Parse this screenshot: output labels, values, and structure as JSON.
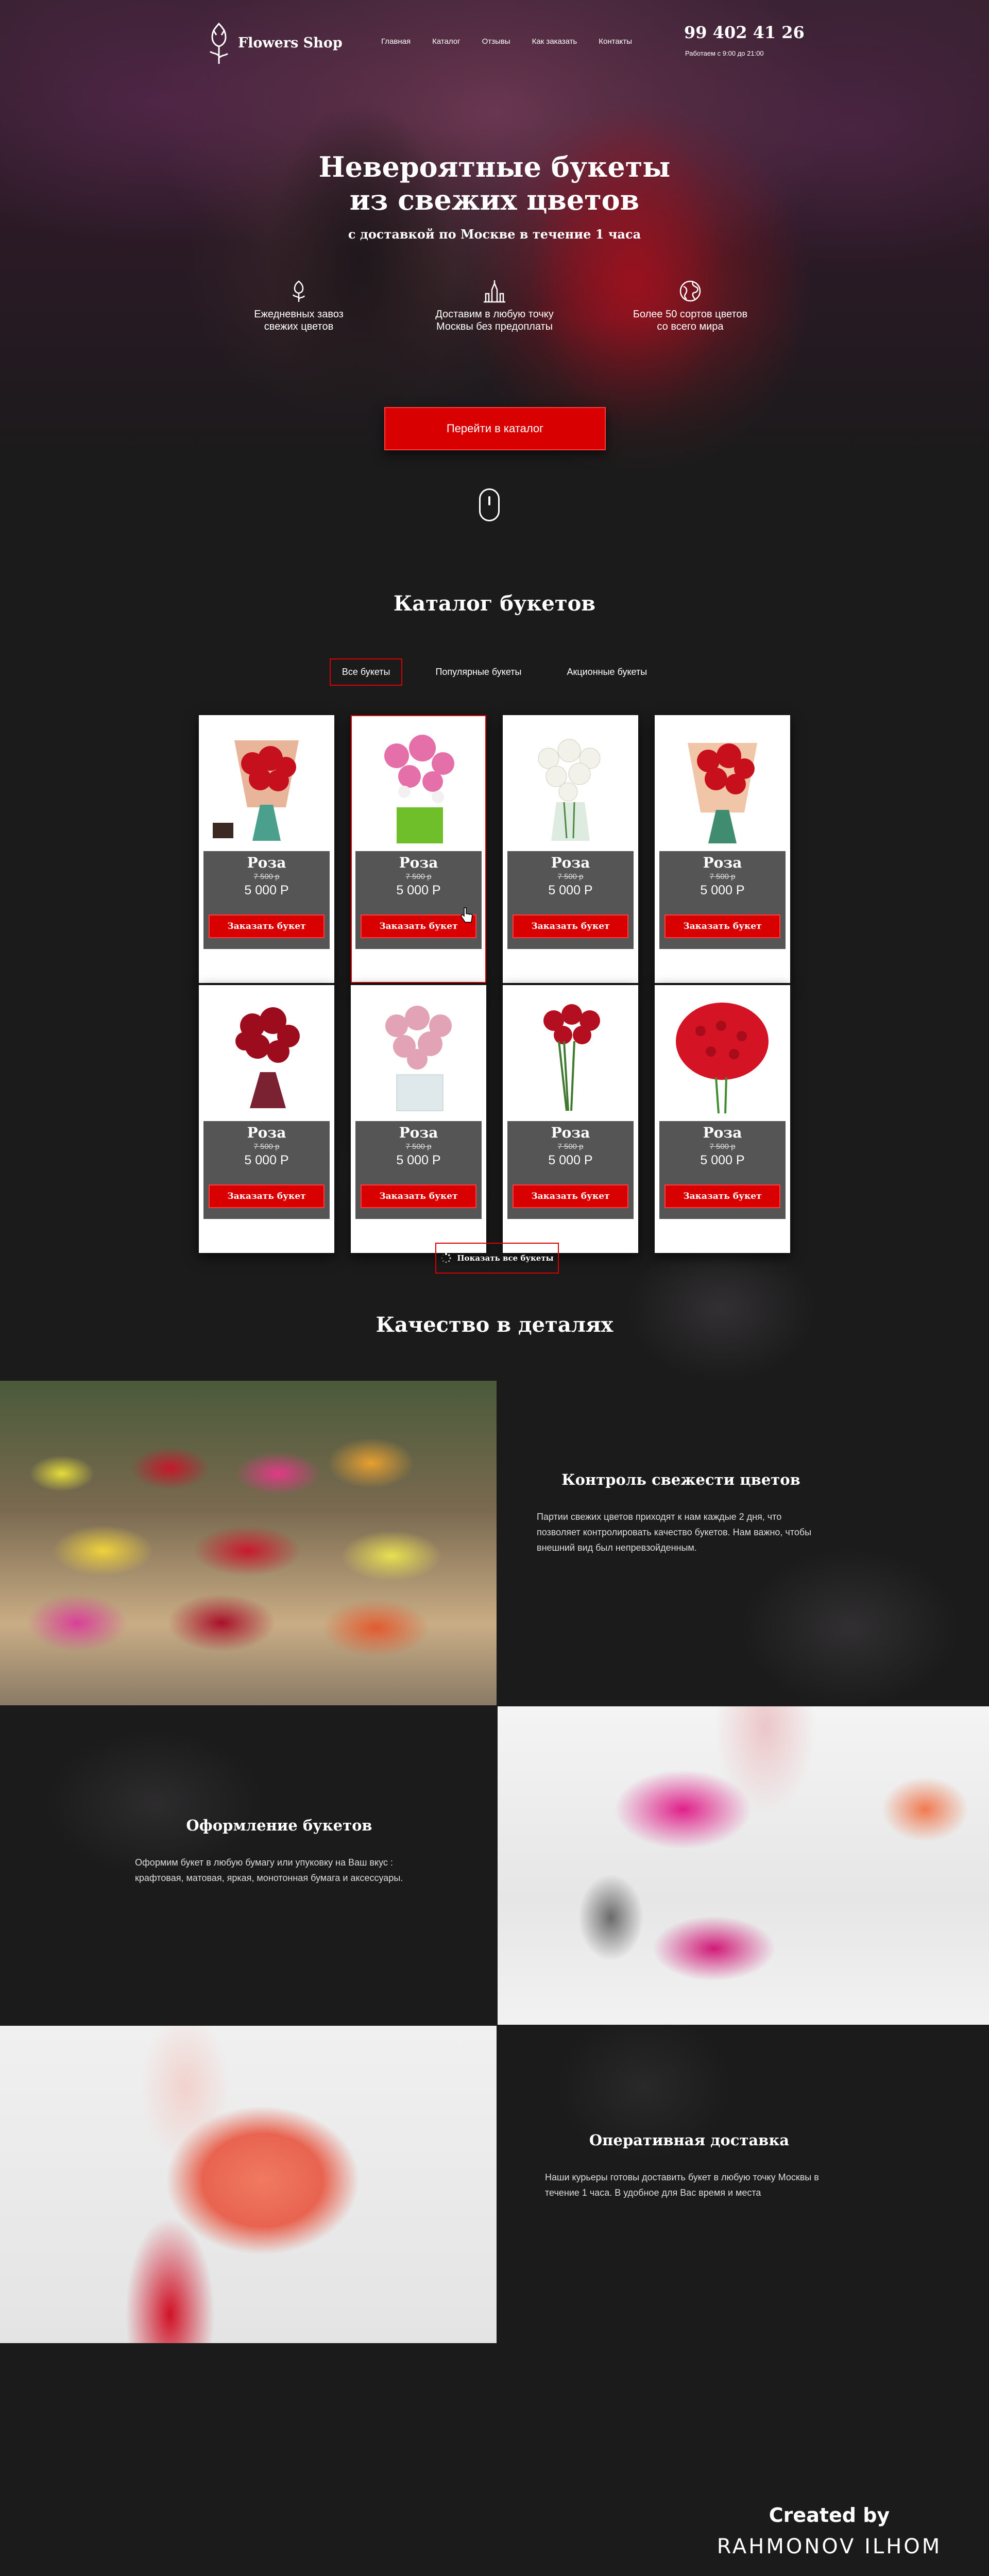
{
  "header": {
    "logo_text": "Flowers Shop",
    "nav": [
      "Главная",
      "Каталог",
      "Отзывы",
      "Как заказать",
      "Контакты"
    ],
    "phone": "99 402 41 26",
    "worktime": "Работаем с 9:00 до 21:00"
  },
  "hero": {
    "title": "Невероятные букеты\nиз свежих цветов",
    "subtitle": "с доставкой по Москве в течение 1 часа",
    "features": [
      {
        "icon": "flower-icon",
        "text": "Ежедневных завоз\nсвежих цветов"
      },
      {
        "icon": "kremlin-icon",
        "text": "Доставим в любую точку\nМосквы без предоплаты"
      },
      {
        "icon": "globe-icon",
        "text": "Более 50 сортов цветов\nсо всего мира"
      }
    ],
    "cta_label": "Перейти в каталог"
  },
  "catalog": {
    "title": "Каталог букетов",
    "tabs": [
      "Все букеты",
      "Популярные букеты",
      "Акционные букеты"
    ],
    "active_tab": 0,
    "order_label": "Заказать букет",
    "products": [
      {
        "name": "Роза",
        "old_price": "7 500 р",
        "price": "5 000 Р",
        "image": "red-roses-craft-wrap"
      },
      {
        "name": "Роза",
        "old_price": "7 500 р",
        "price": "5 000 Р",
        "image": "pink-lilies-green-box"
      },
      {
        "name": "Роза",
        "old_price": "7 500 р",
        "price": "5 000 Р",
        "image": "white-roses-vase"
      },
      {
        "name": "Роза",
        "old_price": "7 500 р",
        "price": "5 000 Р",
        "image": "red-roses-paper-wrap"
      },
      {
        "name": "Роза",
        "old_price": "7 500 р",
        "price": "5 000 Р",
        "image": "dark-red-roses-ribbon"
      },
      {
        "name": "Роза",
        "old_price": "7 500 р",
        "price": "5 000 Р",
        "image": "pink-roses-glass-vase"
      },
      {
        "name": "Роза",
        "old_price": "7 500 р",
        "price": "5 000 Р",
        "image": "long-red-roses"
      },
      {
        "name": "Роза",
        "old_price": "7 500 р",
        "price": "5 000 Р",
        "image": "big-red-roses-bouquet"
      }
    ],
    "show_all_label": "Показать все букеты"
  },
  "quality": {
    "title": "Качество в деталях",
    "items": [
      {
        "title": "Контроль свежести цветов",
        "text": "Партии свежих цветов приходят к нам каждые 2 дня, что позволяет контролировать качество букетов. Нам важно, чтобы внешний вид был непревзойденным."
      },
      {
        "title": "Оформление букетов",
        "text": "Оформим букет в любую бумагу или упуковку на Ваш вкус : крафтовая, матовая, яркая, монотонная бумага и аксессуары."
      },
      {
        "title": "Оперативная доставка",
        "text": "Наши курьеры готовы доставить букет в любую точку Москвы в течение 1 часа. В удобное для Вас время и места"
      }
    ]
  },
  "footer": {
    "created_by": "Created by",
    "author": "RAHMONOV ILHOM"
  },
  "colors": {
    "accent": "#d80000",
    "background": "#1b1b1b",
    "card_body": "#555555"
  }
}
